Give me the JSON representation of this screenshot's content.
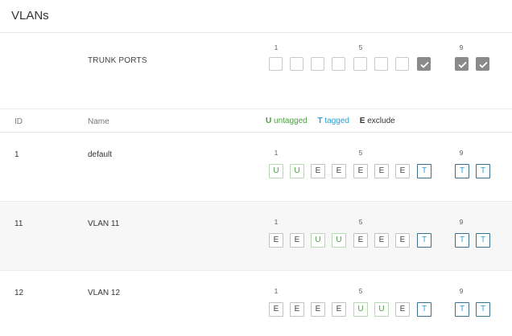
{
  "page": {
    "title": "VLANs"
  },
  "trunk": {
    "label": "TRUNK PORTS",
    "port_labels": [
      "1",
      "5",
      "9"
    ],
    "checked": [
      false,
      false,
      false,
      false,
      false,
      false,
      false,
      true,
      true,
      true
    ]
  },
  "columns": {
    "id": "ID",
    "name": "Name"
  },
  "legend": {
    "u_key": "U",
    "u_text": "untagged",
    "t_key": "T",
    "t_text": "tagged",
    "e_key": "E",
    "e_text": "exclude"
  },
  "vlans": [
    {
      "id": "1",
      "name": "default",
      "port_labels": [
        "1",
        "5",
        "9"
      ],
      "ports": [
        "U",
        "U",
        "E",
        "E",
        "E",
        "E",
        "E",
        "T",
        "T",
        "T"
      ]
    },
    {
      "id": "11",
      "name": "VLAN 11",
      "port_labels": [
        "1",
        "5",
        "9"
      ],
      "ports": [
        "E",
        "E",
        "U",
        "U",
        "E",
        "E",
        "E",
        "T",
        "T",
        "T"
      ]
    },
    {
      "id": "12",
      "name": "VLAN 12",
      "port_labels": [
        "1",
        "5",
        "9"
      ],
      "ports": [
        "E",
        "E",
        "E",
        "E",
        "U",
        "U",
        "E",
        "T",
        "T",
        "T"
      ]
    }
  ],
  "colors": {
    "untagged": "#4aa040",
    "tagged": "#2a9fd6",
    "exclude": "#333333",
    "checked": "#8a8a8a"
  }
}
